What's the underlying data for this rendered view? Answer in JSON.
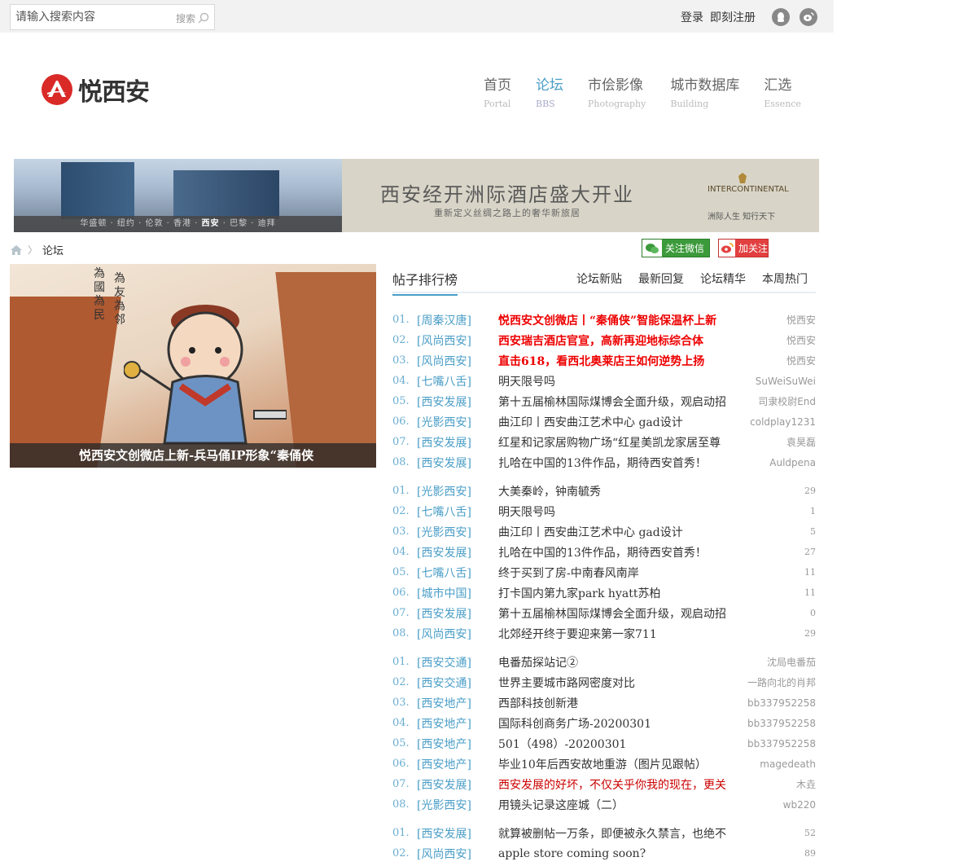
{
  "topbar": {
    "search_placeholder": "请输入搜索内容",
    "search_button": "搜索",
    "login": "登录",
    "register": "即刻注册"
  },
  "header": {
    "logo_text": "悦西安",
    "nav": [
      {
        "cn": "首页",
        "en": "Portal"
      },
      {
        "cn": "论坛",
        "en": "BBS"
      },
      {
        "cn": "市侩影像",
        "en": "Photography"
      },
      {
        "cn": "城市数据库",
        "en": "Building"
      },
      {
        "cn": "汇选",
        "en": "Essence"
      }
    ],
    "active_nav": "论坛"
  },
  "banner": {
    "title": "西安经开洲际酒店盛大开业",
    "subtitle": "重新定义丝绸之路上的奢华新旅居",
    "cities": [
      "华盛顿",
      "纽约",
      "伦敦",
      "香港",
      "西安",
      "巴黎",
      "迪拜"
    ],
    "highlighted_city": "西安",
    "brand": "INTERCONTINENTAL",
    "slogan": "洲际人生 知行天下"
  },
  "breadcrumb": {
    "current": "论坛"
  },
  "follow": {
    "wechat": "关注微信",
    "weibo": "加关注"
  },
  "feature": {
    "caption": "悦西安文创微店上新-兵马俑IP形象“秦俑侠",
    "vertical_text_1": "為國為民",
    "vertical_text_2": "為友為邻"
  },
  "ranking": {
    "title": "帖子排行榜",
    "tabs": [
      "论坛新贴",
      "最新回复",
      "论坛精华",
      "本周热门"
    ],
    "groups": [
      [
        {
          "num": "01.",
          "cat": "[周秦汉唐]",
          "title": "悦西安文创微店丨“秦俑侠”智能保温杯上新",
          "meta": "悦西安",
          "style": "hl"
        },
        {
          "num": "02.",
          "cat": "[风尚西安]",
          "title": "西安瑞吉酒店官宣，高新再迎地标综合体",
          "meta": "悦西安",
          "style": "hl"
        },
        {
          "num": "03.",
          "cat": "[风尚西安]",
          "title": "直击618，看西北奥莱店王如何逆势上扬",
          "meta": "悦西安",
          "style": "hl"
        },
        {
          "num": "04.",
          "cat": "[七嘴八舌]",
          "title": "明天限号吗",
          "meta": "SuWeiSuWei",
          "style": ""
        },
        {
          "num": "05.",
          "cat": "[西安发展]",
          "title": "第十五届榆林国际煤博会全面升级，观启动招",
          "meta": "司隶校尉End",
          "style": ""
        },
        {
          "num": "06.",
          "cat": "[光影西安]",
          "title": "曲江印丨西安曲江艺术中心 gad设计",
          "meta": "coldplay1231",
          "style": ""
        },
        {
          "num": "07.",
          "cat": "[西安发展]",
          "title": "红星和记家居购物广场“红星美凯龙家居至尊",
          "meta": "袁昊磊",
          "style": ""
        },
        {
          "num": "08.",
          "cat": "[西安发展]",
          "title": "扎哈在中国的13件作品，期待西安首秀！",
          "meta": "Auldpena",
          "style": ""
        }
      ],
      [
        {
          "num": "01.",
          "cat": "[光影西安]",
          "title": "大美秦岭，钟南毓秀",
          "meta": "29",
          "style": ""
        },
        {
          "num": "02.",
          "cat": "[七嘴八舌]",
          "title": "明天限号吗",
          "meta": "1",
          "style": ""
        },
        {
          "num": "03.",
          "cat": "[光影西安]",
          "title": "曲江印丨西安曲江艺术中心 gad设计",
          "meta": "5",
          "style": ""
        },
        {
          "num": "04.",
          "cat": "[西安发展]",
          "title": "扎哈在中国的13件作品，期待西安首秀！",
          "meta": "27",
          "style": ""
        },
        {
          "num": "05.",
          "cat": "[七嘴八舌]",
          "title": "终于买到了房-中南春风南岸",
          "meta": "11",
          "style": ""
        },
        {
          "num": "06.",
          "cat": "[城市中国]",
          "title": "打卡国内第九家park hyatt苏柏",
          "meta": "11",
          "style": ""
        },
        {
          "num": "07.",
          "cat": "[西安发展]",
          "title": "第十五届榆林国际煤博会全面升级，观启动招",
          "meta": "0",
          "style": ""
        },
        {
          "num": "08.",
          "cat": "[风尚西安]",
          "title": "北郊经开终于要迎来第一家711",
          "meta": "29",
          "style": ""
        }
      ],
      [
        {
          "num": "01.",
          "cat": "[西安交通]",
          "title": "电番茄探站记②",
          "meta": "沈局电番茄",
          "style": ""
        },
        {
          "num": "02.",
          "cat": "[西安交通]",
          "title": "世界主要城市路网密度对比",
          "meta": "一路向北的肖邦",
          "style": ""
        },
        {
          "num": "03.",
          "cat": "[西安地产]",
          "title": "西部科技创新港",
          "meta": "bb337952258",
          "style": ""
        },
        {
          "num": "04.",
          "cat": "[西安地产]",
          "title": "国际科创商务广场-20200301",
          "meta": "bb337952258",
          "style": ""
        },
        {
          "num": "05.",
          "cat": "[西安地产]",
          "title": "501（498）-20200301",
          "meta": "bb337952258",
          "style": ""
        },
        {
          "num": "06.",
          "cat": "[西安地产]",
          "title": "毕业10年后西安故地重游（图片见跟帖）",
          "meta": "magedeath",
          "style": ""
        },
        {
          "num": "07.",
          "cat": "[西安发展]",
          "title": "西安发展的好坏，不仅关乎你我的现在，更关",
          "meta": "木垚",
          "style": "red"
        },
        {
          "num": "08.",
          "cat": "[光影西安]",
          "title": "用镜头记录这座城（二）",
          "meta": "wb220",
          "style": ""
        }
      ],
      [
        {
          "num": "01.",
          "cat": "[西安发展]",
          "title": "就算被删帖一万条，即便被永久禁言，也绝不",
          "meta": "52",
          "style": ""
        },
        {
          "num": "02.",
          "cat": "[风尚西安]",
          "title": "apple store coming soon?",
          "meta": "89",
          "style": ""
        }
      ]
    ]
  }
}
